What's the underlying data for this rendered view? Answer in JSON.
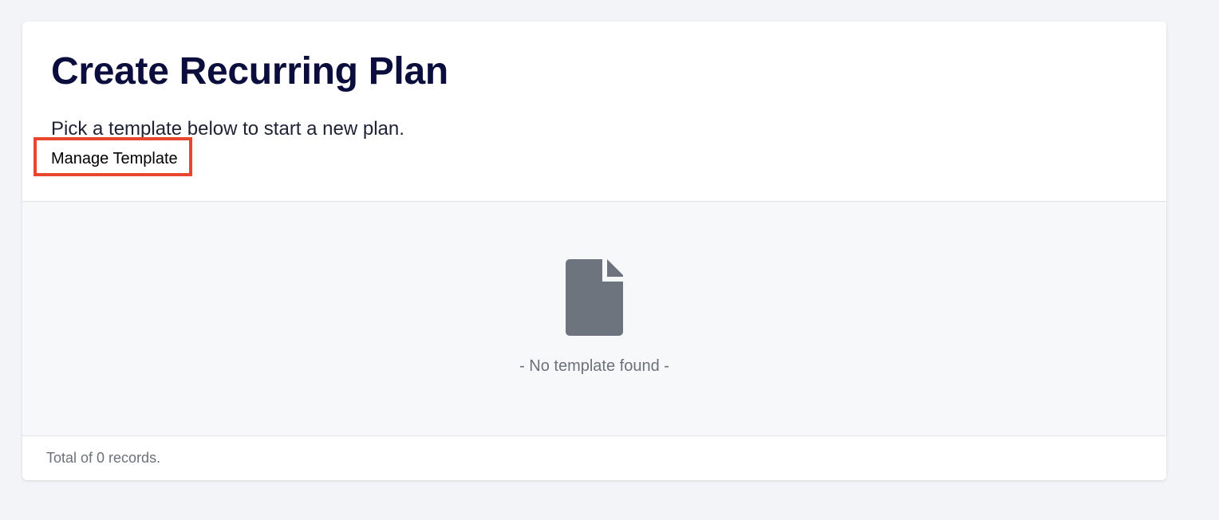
{
  "page": {
    "title": "Create Recurring Plan",
    "subtitle": "Pick a template below to start a new plan.",
    "manage_template_label": "Manage Template",
    "highlight_color": "#e8472f"
  },
  "empty_state": {
    "icon": "document-icon",
    "message": "- No template found -"
  },
  "footer": {
    "record_count_text": "Total of 0 records."
  }
}
